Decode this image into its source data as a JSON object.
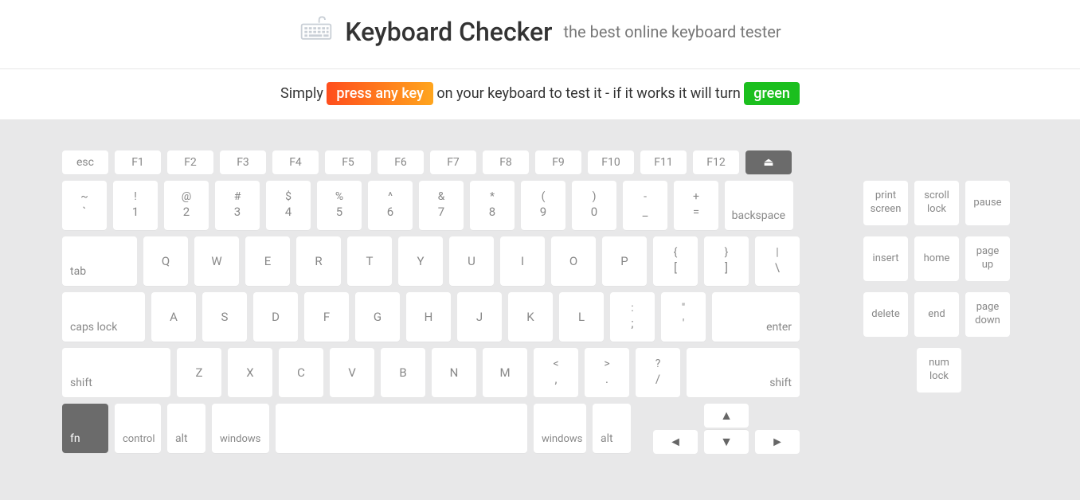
{
  "header": {
    "title_main": "Keyboard Checker",
    "title_sub": "the best online keyboard tester"
  },
  "instruction": {
    "pre": "Simply ",
    "badge1": "press any key",
    "mid": " on your keyboard to test it - if it works it will turn ",
    "badge2": "green"
  },
  "func_row": [
    "esc",
    "F1",
    "F2",
    "F3",
    "F4",
    "F5",
    "F6",
    "F7",
    "F8",
    "F9",
    "F10",
    "F11",
    "F12"
  ],
  "eject_glyph": "⏏",
  "num_row": [
    {
      "t": "~",
      "b": "`"
    },
    {
      "t": "!",
      "b": "1"
    },
    {
      "t": "@",
      "b": "2"
    },
    {
      "t": "#",
      "b": "3"
    },
    {
      "t": "$",
      "b": "4"
    },
    {
      "t": "%",
      "b": "5"
    },
    {
      "t": "^",
      "b": "6"
    },
    {
      "t": "&",
      "b": "7"
    },
    {
      "t": "*",
      "b": "8"
    },
    {
      "t": "(",
      "b": "9"
    },
    {
      "t": ")",
      "b": "0"
    },
    {
      "t": "-",
      "b": "_"
    },
    {
      "t": "+",
      "b": "="
    }
  ],
  "backspace": "backspace",
  "tab": "tab",
  "q_row": [
    "Q",
    "W",
    "E",
    "R",
    "T",
    "Y",
    "U",
    "I",
    "O",
    "P"
  ],
  "q_tail": [
    {
      "t": "{",
      "b": "["
    },
    {
      "t": "}",
      "b": "]"
    },
    {
      "t": "|",
      "b": "\\"
    }
  ],
  "caps": "caps lock",
  "a_row": [
    "A",
    "S",
    "D",
    "F",
    "G",
    "H",
    "J",
    "K",
    "L"
  ],
  "a_tail": [
    {
      "t": ":",
      "b": ";"
    },
    {
      "t": "\"",
      "b": "'"
    }
  ],
  "enter": "enter",
  "shift_l": "shift",
  "z_row": [
    "Z",
    "X",
    "C",
    "V",
    "B",
    "N",
    "M"
  ],
  "z_tail": [
    {
      "t": "<",
      "b": ","
    },
    {
      "t": ">",
      "b": "."
    },
    {
      "t": "?",
      "b": "/"
    }
  ],
  "shift_r": "shift",
  "space_row": {
    "fn": "fn",
    "ctrl": "control",
    "alt": "alt",
    "win": "windows",
    "win2": "windows",
    "alt2": "alt"
  },
  "arrows": {
    "up": "▲",
    "down": "▼",
    "left": "◄",
    "right": "►"
  },
  "nav": {
    "r1": [
      {
        "a": "print",
        "b": "screen"
      },
      {
        "a": "scroll",
        "b": "lock"
      },
      {
        "a": "pause",
        "b": ""
      }
    ],
    "r2": [
      {
        "a": "insert",
        "b": ""
      },
      {
        "a": "home",
        "b": ""
      },
      {
        "a": "page",
        "b": "up"
      }
    ],
    "r3": [
      {
        "a": "delete",
        "b": ""
      },
      {
        "a": "end",
        "b": ""
      },
      {
        "a": "page",
        "b": "down"
      }
    ],
    "r4": [
      {
        "a": "num",
        "b": "lock"
      }
    ]
  }
}
